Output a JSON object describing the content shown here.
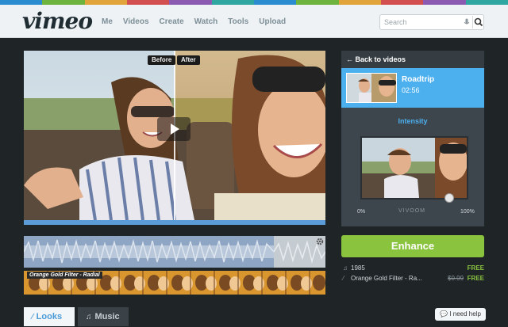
{
  "header": {
    "logo": "vimeo",
    "nav": [
      "Me",
      "Videos",
      "Create",
      "Watch",
      "Tools",
      "Upload"
    ],
    "search_placeholder": "Search"
  },
  "video": {
    "before_label": "Before",
    "after_label": "After"
  },
  "filmstrip": {
    "label": "Orange Gold Filter - Radial"
  },
  "tabs": [
    {
      "label": "Looks",
      "icon": "wand-icon"
    },
    {
      "label": "Music",
      "icon": "music-note-icon"
    }
  ],
  "help_label": "I need help",
  "panel": {
    "back_label": "Back to videos",
    "video_title": "Roadtrip",
    "video_duration": "02:56",
    "intensity_label": "Intensity",
    "intensity_value": 0.82,
    "min_label": "0%",
    "max_label": "100%",
    "brand_mark": "VIVOOM"
  },
  "enhance_label": "Enhance",
  "tracks": [
    {
      "icon": "music-note-icon",
      "name": "1985",
      "old_price": "",
      "price": "FREE"
    },
    {
      "icon": "wand-icon",
      "name": "Orange Gold Filter - Ra...",
      "old_price": "$0.99",
      "price": "FREE"
    }
  ],
  "colors": {
    "accent_blue": "#4cb0ef",
    "enhance_green": "#8ac43f",
    "filmstrip_orange": "#e1a53a"
  }
}
